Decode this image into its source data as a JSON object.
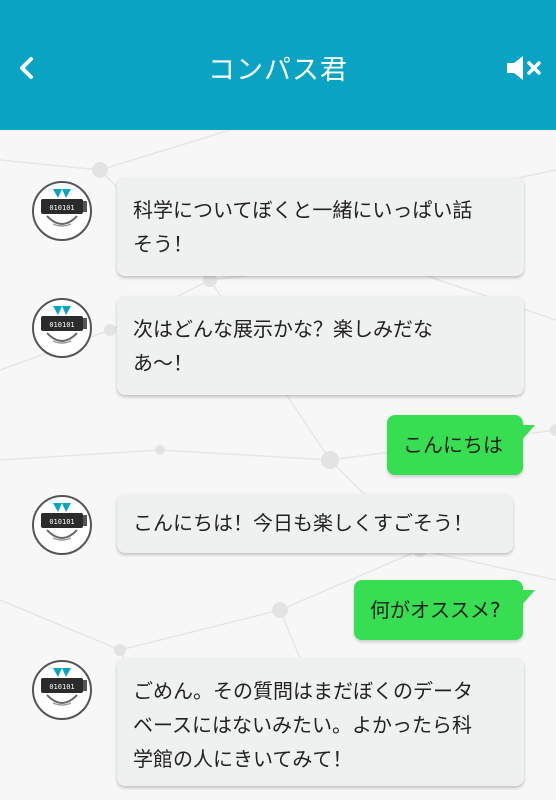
{
  "header": {
    "title": "コンパス君",
    "back_icon": "chevron-left-icon",
    "mute_icon": "speaker-mute-icon",
    "bg_color": "#0aa3c4"
  },
  "avatar": {
    "visor_text": "010101"
  },
  "messages": [
    {
      "sender": "bot",
      "text": "科学についてぼくと一緒にいっぱい話\nそう！"
    },
    {
      "sender": "bot",
      "text": "次はどんな展示かな？楽しみだな\nあ～！"
    },
    {
      "sender": "user",
      "text": "こんにちは"
    },
    {
      "sender": "bot",
      "text": "こんにちは！今日も楽しくすごそう！"
    },
    {
      "sender": "user",
      "text": "何がオススメ?"
    },
    {
      "sender": "bot",
      "text": "ごめん。その質問はまだぼくのデータ\nベースにはないみたい。よかったら科\n学館の人にきいてみて！"
    }
  ],
  "colors": {
    "user_bubble": "#37de52",
    "bot_bubble": "#eef1ef"
  }
}
